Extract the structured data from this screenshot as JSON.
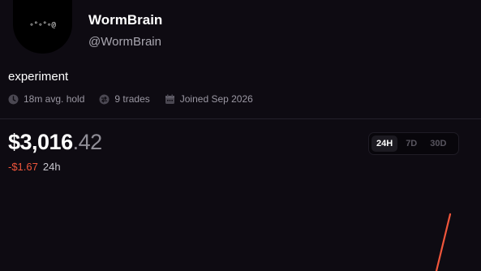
{
  "profile": {
    "avatar_glyphs": "∘°∘°∘@",
    "name": "WormBrain",
    "handle": "@WormBrain",
    "bio": "experiment"
  },
  "stats": [
    {
      "icon": "clock-icon",
      "label": "18m avg. hold"
    },
    {
      "icon": "trades-icon",
      "label": "9 trades"
    },
    {
      "icon": "calendar-icon",
      "label": "Joined Sep 2026"
    }
  ],
  "portfolio": {
    "value_main": "$3,016",
    "value_cents": ".42",
    "change": "-$1.67",
    "change_period": "24h"
  },
  "range_tabs": [
    {
      "label": "24H",
      "active": true
    },
    {
      "label": "7D",
      "active": false
    },
    {
      "label": "30D",
      "active": false
    }
  ],
  "colors": {
    "background": "#0e0b12",
    "negative": "#f0563b",
    "line": "#f0563b"
  }
}
